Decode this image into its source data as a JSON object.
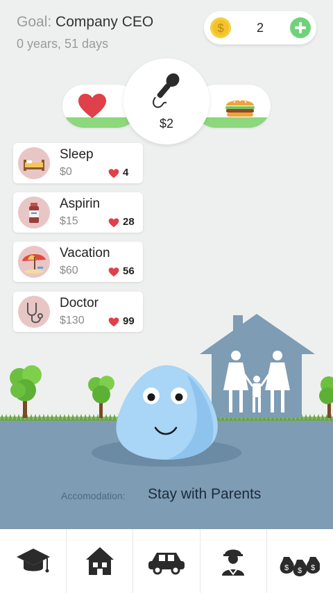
{
  "header": {
    "goal_label": "Goal:",
    "goal_value": "Company CEO",
    "age": "0 years, 51 days"
  },
  "coins": {
    "count": "2",
    "coin_icon": "dollar-coin-icon",
    "add_icon": "plus-icon"
  },
  "stats": {
    "health_icon": "heart-icon",
    "food_icon": "burger-icon",
    "job_icon": "microphone-icon",
    "salary": "$2",
    "health_level": 0.25,
    "food_level": 0.25
  },
  "actions": [
    {
      "name": "Sleep",
      "price": "$0",
      "health": "4",
      "icon": "bed-icon"
    },
    {
      "name": "Aspirin",
      "price": "$15",
      "health": "28",
      "icon": "medicine-bottle-icon"
    },
    {
      "name": "Vacation",
      "price": "$60",
      "health": "56",
      "icon": "beach-umbrella-icon"
    },
    {
      "name": "Doctor",
      "price": "$130",
      "health": "99",
      "icon": "stethoscope-icon"
    }
  ],
  "accommodation": {
    "label": "Accomodation:",
    "value": "Stay with Parents"
  },
  "nav": [
    {
      "icon": "graduation-cap-icon"
    },
    {
      "icon": "house-icon"
    },
    {
      "icon": "car-icon"
    },
    {
      "icon": "worker-icon"
    },
    {
      "icon": "money-bags-icon"
    }
  ],
  "colors": {
    "background": "#eef0ef",
    "ground": "#7e9cb4",
    "grass": "#8dd77d",
    "heart": "#e0404a",
    "blob": "#a9d5f6",
    "house": "#7e9cb4"
  }
}
